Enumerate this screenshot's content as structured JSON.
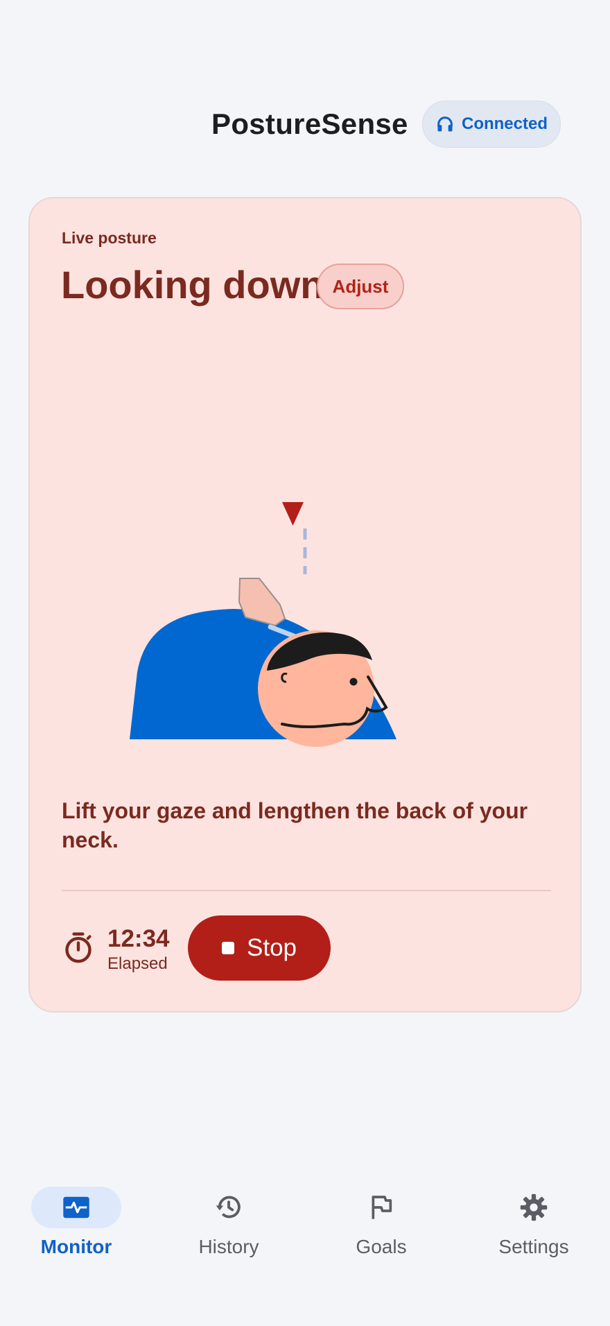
{
  "header": {
    "app_title": "PostureSense",
    "connection": {
      "label": "Connected",
      "icon": "headphones-icon"
    }
  },
  "card": {
    "live_label": "Live posture",
    "status_title": "Looking down",
    "adjust_label": "Adjust",
    "tip": "Lift your gaze and lengthen the back of your neck.",
    "elapsed": {
      "value": "12:34",
      "label": "Elapsed"
    },
    "stop_label": "Stop"
  },
  "nav": {
    "items": [
      {
        "label": "Monitor",
        "icon": "pulse-icon",
        "active": true
      },
      {
        "label": "History",
        "icon": "history-icon",
        "active": false
      },
      {
        "label": "Goals",
        "icon": "flag-icon",
        "active": false
      },
      {
        "label": "Settings",
        "icon": "gear-icon",
        "active": false
      }
    ]
  },
  "colors": {
    "accent": "#0f62c7",
    "alert": "#b21f18",
    "alert_text": "#7a2a1f",
    "card_bg": "#fde3e0"
  }
}
